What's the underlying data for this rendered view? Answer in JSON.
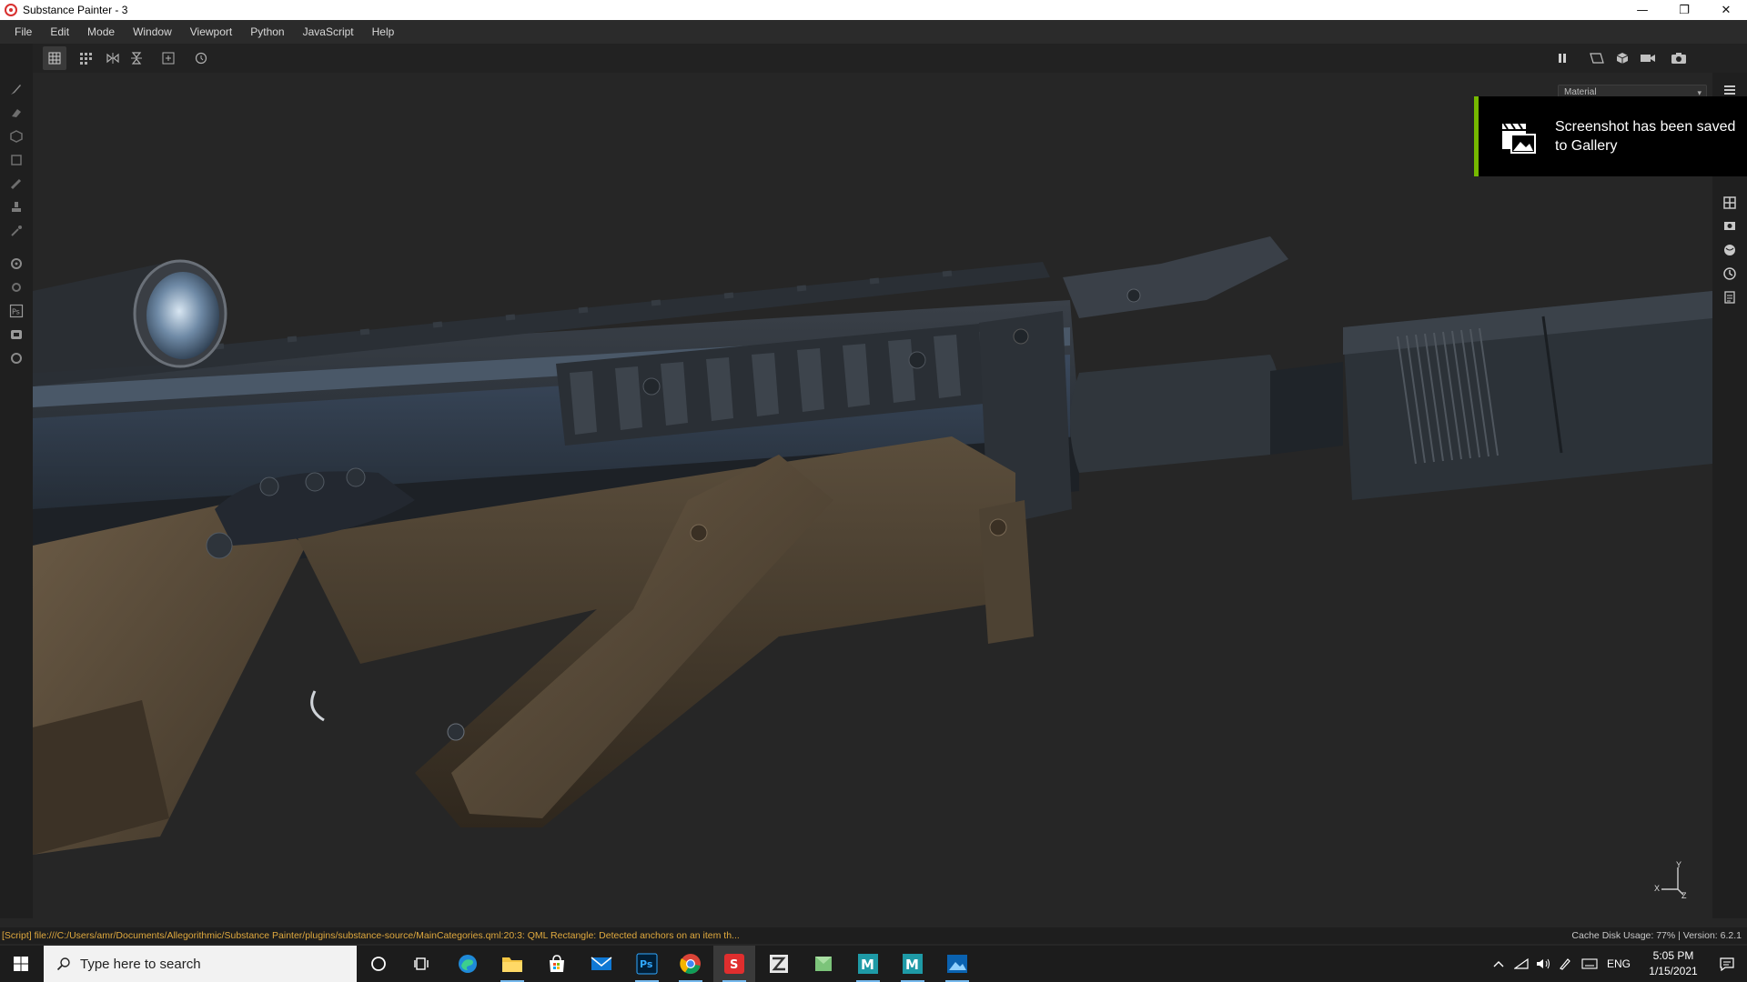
{
  "window": {
    "title": "Substance Painter - 3"
  },
  "menu": [
    "File",
    "Edit",
    "Mode",
    "Window",
    "Viewport",
    "Python",
    "JavaScript",
    "Help"
  ],
  "viewport": {
    "material_dropdown": "Material",
    "axis": {
      "x": "X",
      "y": "Y",
      "z": "Z"
    }
  },
  "notification": {
    "text": "Screenshot has been saved to Gallery"
  },
  "status": {
    "log": "[Script] file:///C:/Users/amr/Documents/Allegorithmic/Substance Painter/plugins/substance-source/MainCategories.qml:20:3: QML Rectangle: Detected anchors on an item th...",
    "cache": "Cache Disk Usage:  77% | Version: 6.2.1"
  },
  "taskbar": {
    "search_placeholder": "Type here to search",
    "language": "ENG",
    "time": "5:05 PM",
    "date": "1/15/2021",
    "apps": [
      "cortana",
      "task-view",
      "edge",
      "file-explorer",
      "store",
      "mail",
      "photoshop",
      "chrome",
      "substance-painter",
      "zbrush",
      "app-green",
      "maya",
      "maya-2",
      "photos"
    ]
  },
  "colors": {
    "accent_nvidia": "#76b900",
    "status_log": "#e0a93e"
  }
}
